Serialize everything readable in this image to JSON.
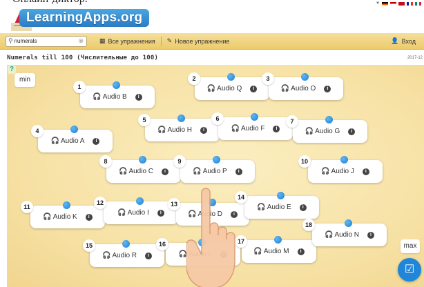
{
  "top_strip": {
    "cut_text": "Онлайн-диктор."
  },
  "header": {
    "logo_text": "LearningApps.org"
  },
  "toolbar": {
    "search_value": "numerals",
    "all_exercises": "Все упражнения",
    "new_exercise": "Новое упражнение",
    "login": "Вход"
  },
  "page": {
    "title": "Numerals till 100 (Числительные до 100)",
    "date": "2017-12"
  },
  "board": {
    "min_label": "min",
    "max_label": "max"
  },
  "cards": [
    {
      "number": "1",
      "label": "Audio B"
    },
    {
      "number": "2",
      "label": "Audio Q"
    },
    {
      "number": "3",
      "label": "Audio O"
    },
    {
      "number": "4",
      "label": "Audio A"
    },
    {
      "number": "5",
      "label": "Audio H"
    },
    {
      "number": "6",
      "label": "Audio F"
    },
    {
      "number": "7",
      "label": "Audio G"
    },
    {
      "number": "8",
      "label": "Audio C"
    },
    {
      "number": "9",
      "label": "Audio P"
    },
    {
      "number": "10",
      "label": "Audio J"
    },
    {
      "number": "11",
      "label": "Audio K"
    },
    {
      "number": "12",
      "label": "Audio I"
    },
    {
      "number": "13",
      "label": "Audio D"
    },
    {
      "number": "14",
      "label": "Audio E"
    },
    {
      "number": "15",
      "label": "Audio R"
    },
    {
      "number": "16",
      "label": "Audio L"
    },
    {
      "number": "17",
      "label": "Audio M"
    },
    {
      "number": "18",
      "label": "Audio N"
    }
  ],
  "colors": {
    "accent": "#1f86d9",
    "toolbar": "#eccb6c",
    "board": "#f7e2a6"
  }
}
